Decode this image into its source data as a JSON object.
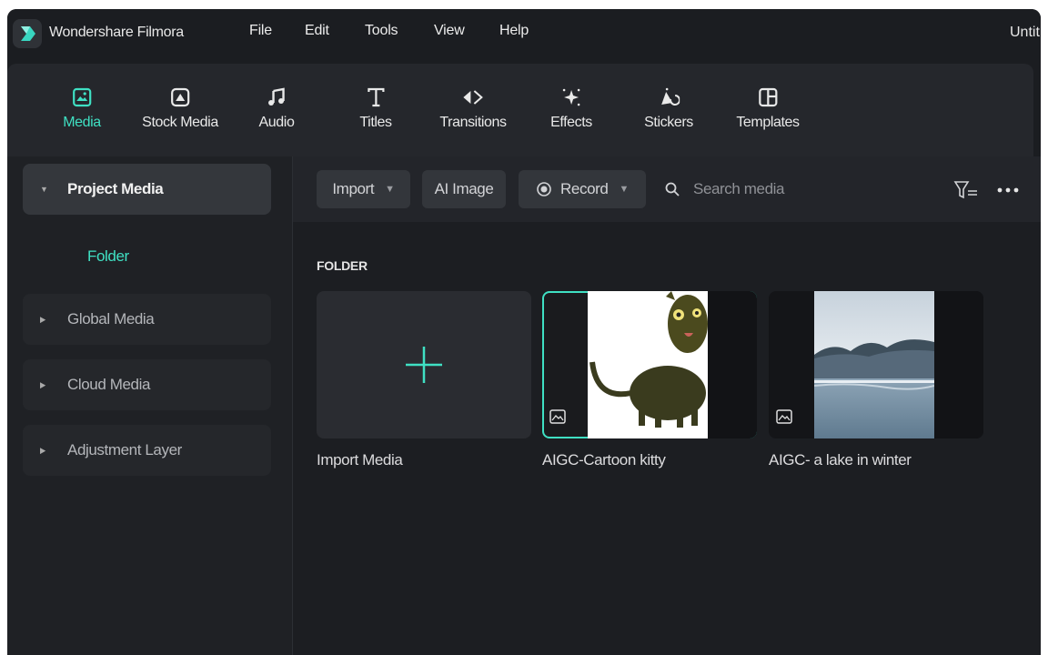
{
  "app": {
    "name": "Wondershare Filmora",
    "doc_title": "Untit"
  },
  "menu": [
    "File",
    "Edit",
    "Tools",
    "View",
    "Help"
  ],
  "toolbar": {
    "tabs": [
      {
        "label": "Media",
        "icon": "media-icon",
        "active": true
      },
      {
        "label": "Stock Media",
        "icon": "stock-media-icon",
        "active": false
      },
      {
        "label": "Audio",
        "icon": "music-note-icon",
        "active": false
      },
      {
        "label": "Titles",
        "icon": "text-t-icon",
        "active": false
      },
      {
        "label": "Transitions",
        "icon": "transitions-icon",
        "active": false
      },
      {
        "label": "Effects",
        "icon": "effects-sparkle-icon",
        "active": false
      },
      {
        "label": "Stickers",
        "icon": "stickers-icon",
        "active": false
      },
      {
        "label": "Templates",
        "icon": "templates-icon",
        "active": false
      }
    ]
  },
  "sidebar": {
    "project_media": "Project Media",
    "folder": "Folder",
    "items": [
      "Global Media",
      "Cloud Media",
      "Adjustment Layer"
    ]
  },
  "filterbar": {
    "import": "Import",
    "ai_image": "AI Image",
    "record": "Record",
    "search_placeholder": "Search media"
  },
  "content": {
    "folder_label": "FOLDER",
    "cards": [
      {
        "name": "Import Media",
        "kind": "import"
      },
      {
        "name": "AIGC-Cartoon kitty",
        "kind": "image",
        "selected": true
      },
      {
        "name": "AIGC- a lake in winter",
        "kind": "image",
        "selected": false
      }
    ]
  },
  "colors": {
    "accent": "#3fe0c3",
    "background": "#1b1d21",
    "panel": "#25272c"
  }
}
